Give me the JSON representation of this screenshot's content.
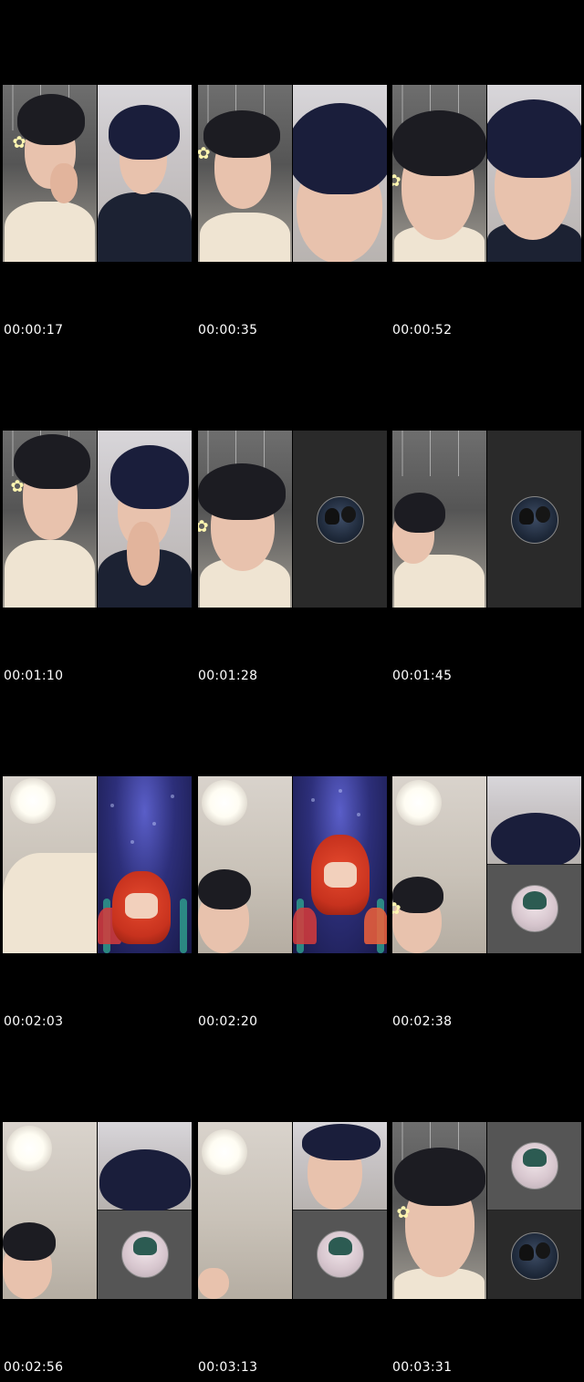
{
  "sheet": {
    "timestamps": [
      "00:00:17",
      "00:00:35",
      "00:00:52",
      "00:01:10",
      "00:01:28",
      "00:01:45",
      "00:02:03",
      "00:02:20",
      "00:02:38",
      "00:02:56",
      "00:03:13",
      "00:03:31"
    ]
  },
  "colors": {
    "background": "#000000",
    "timestamp_text": "#ffffff"
  },
  "icons": {
    "flower": "flower-hair-clip-icon",
    "avatar": "profile-avatar-icon"
  }
}
